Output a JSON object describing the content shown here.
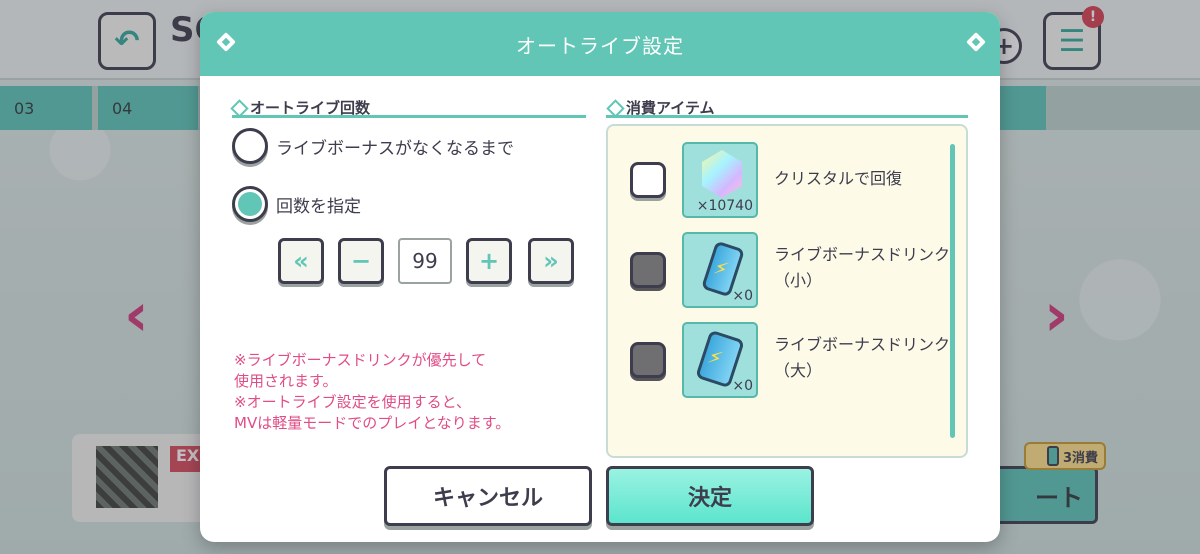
{
  "background": {
    "song_title_fragment": "SC",
    "tabs": [
      "03",
      "04"
    ],
    "difficulty_fragment": "EX",
    "start_fragment": "ート",
    "cost_label": "3消費"
  },
  "dialog": {
    "title": "オートライブ設定",
    "left_section": {
      "heading": "オートライブ回数",
      "options": [
        {
          "label": "ライブボーナスがなくなるまで",
          "selected": false
        },
        {
          "label": "回数を指定",
          "selected": true
        }
      ],
      "stepper": {
        "value": "99",
        "buttons": {
          "min": "«",
          "minus": "−",
          "plus": "+",
          "max": "»"
        }
      },
      "notes": [
        "※ライブボーナスドリンクが優先して",
        "使用されます。",
        "※オートライブ設定を使用すると、",
        "MVは軽量モードでのプレイとなります。"
      ]
    },
    "right_section": {
      "heading": "消費アイテム",
      "items": [
        {
          "label": "クリスタルで回復",
          "count": "×10740",
          "checked": false,
          "enabled": true,
          "icon": "crystal-icon"
        },
        {
          "label": "ライブボーナスドリンク（小）",
          "count": "×0",
          "checked": false,
          "enabled": false,
          "icon": "drink-small-icon"
        },
        {
          "label": "ライブボーナスドリンク（大）",
          "count": "×0",
          "checked": false,
          "enabled": false,
          "icon": "drink-large-icon"
        }
      ]
    },
    "buttons": {
      "cancel": "キャンセル",
      "confirm": "決定"
    }
  },
  "colors": {
    "accent": "#61c6b5",
    "note_text": "#e04d86",
    "panel_bg": "#fdfbe8",
    "outline": "#3d3d4d"
  }
}
